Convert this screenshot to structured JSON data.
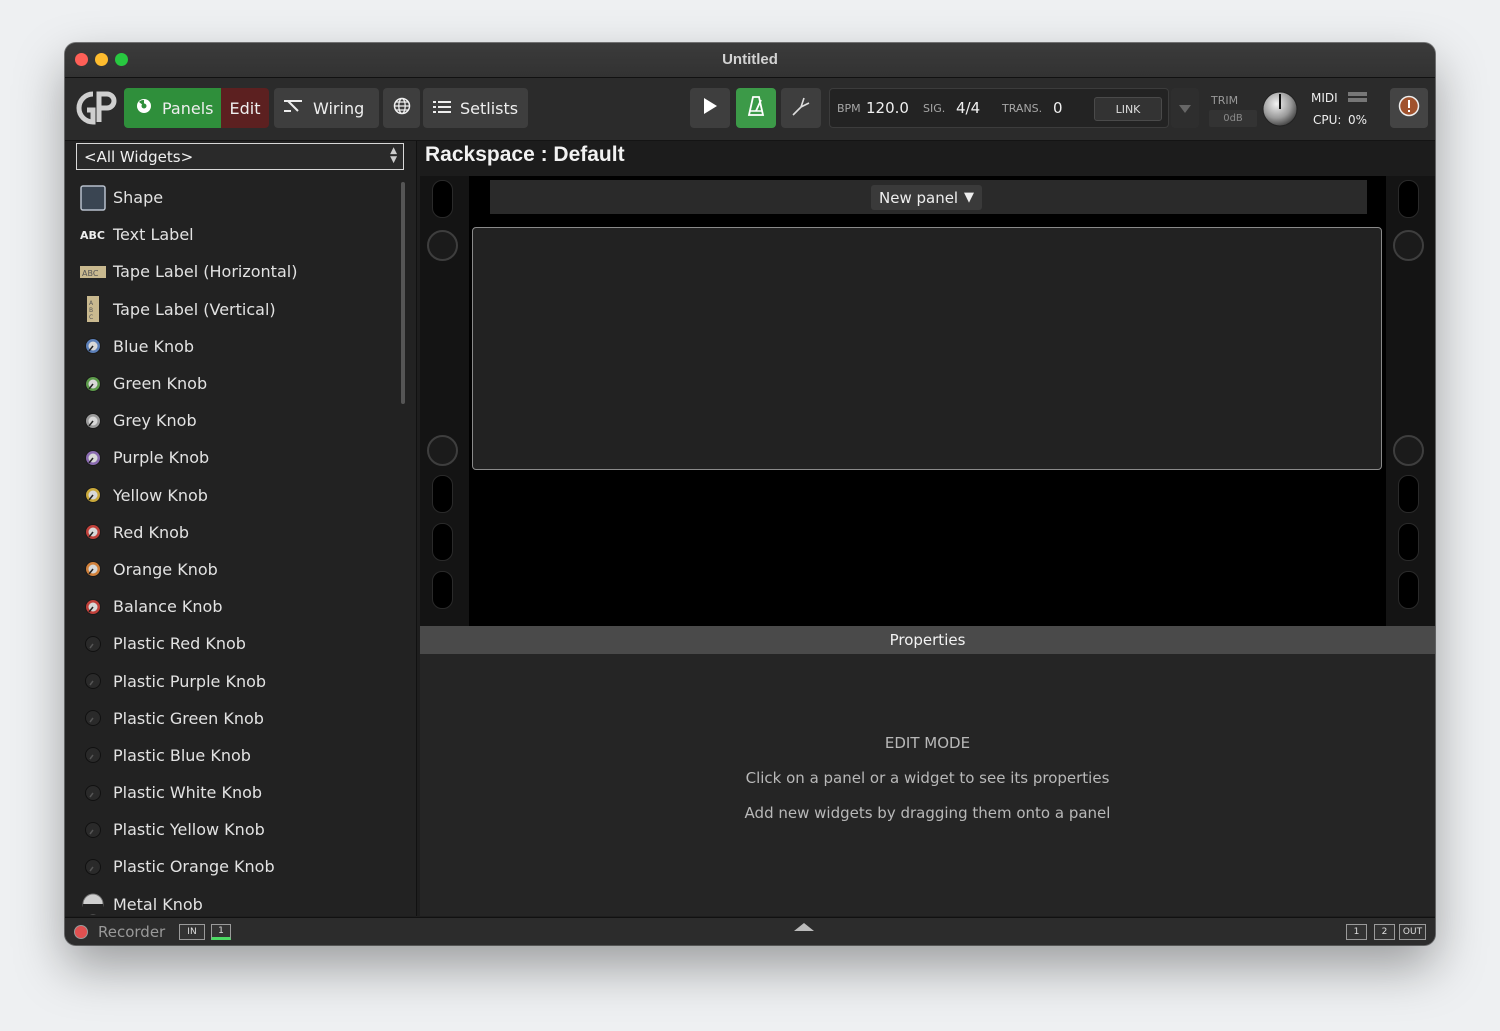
{
  "window": {
    "title": "Untitled"
  },
  "toolbar": {
    "panels_label": "Panels",
    "edit_label": "Edit",
    "wiring_label": "Wiring",
    "setlists_label": "Setlists",
    "bpm_label": "BPM",
    "bpm_value": "120.0",
    "sig_label": "SIG.",
    "sig_value": "4/4",
    "trans_label": "TRANS.",
    "trans_value": "0",
    "link_label": "LINK",
    "trim_label": "TRIM",
    "trim_value": "0dB",
    "midi_label": "MIDI",
    "cpu_label": "CPU:",
    "cpu_value": "0%"
  },
  "sidebar": {
    "filter_value": "<All Widgets>",
    "items": [
      {
        "label": "Shape",
        "icon": "shape-icon"
      },
      {
        "label": "Text Label",
        "icon": "text-label-icon"
      },
      {
        "label": "Tape Label (Horizontal)",
        "icon": "tape-label-horizontal-icon"
      },
      {
        "label": "Tape Label (Vertical)",
        "icon": "tape-label-vertical-icon"
      },
      {
        "label": "Blue Knob",
        "icon": "blue-knob-icon"
      },
      {
        "label": "Green Knob",
        "icon": "green-knob-icon"
      },
      {
        "label": "Grey Knob",
        "icon": "grey-knob-icon"
      },
      {
        "label": "Purple Knob",
        "icon": "purple-knob-icon"
      },
      {
        "label": "Yellow Knob",
        "icon": "yellow-knob-icon"
      },
      {
        "label": "Red Knob",
        "icon": "red-knob-icon"
      },
      {
        "label": "Orange Knob",
        "icon": "orange-knob-icon"
      },
      {
        "label": "Balance Knob",
        "icon": "balance-knob-icon"
      },
      {
        "label": "Plastic Red Knob",
        "icon": "plastic-red-knob-icon"
      },
      {
        "label": "Plastic Purple Knob",
        "icon": "plastic-purple-knob-icon"
      },
      {
        "label": "Plastic Green Knob",
        "icon": "plastic-green-knob-icon"
      },
      {
        "label": "Plastic Blue Knob",
        "icon": "plastic-blue-knob-icon"
      },
      {
        "label": "Plastic White Knob",
        "icon": "plastic-white-knob-icon"
      },
      {
        "label": "Plastic Yellow Knob",
        "icon": "plastic-yellow-knob-icon"
      },
      {
        "label": "Plastic Orange Knob",
        "icon": "plastic-orange-knob-icon"
      },
      {
        "label": "Metal Knob",
        "icon": "metal-knob-icon"
      }
    ]
  },
  "main": {
    "rackspace_title": "Rackspace : Default",
    "new_panel_label": "New panel"
  },
  "properties": {
    "header": "Properties",
    "mode": "EDIT MODE",
    "hint1": "Click on a panel or a widget to see its properties",
    "hint2": "Add new widgets by dragging them onto a panel"
  },
  "statusbar": {
    "recorder_label": "Recorder",
    "in_label": "IN",
    "in_channel": "1",
    "out_channel_1": "1",
    "out_channel_2": "2",
    "out_label": "OUT"
  },
  "colors": {
    "panels_active": "#2f8f3b",
    "edit_active": "#5c2020",
    "metronome_active": "#3c9a48",
    "recorder_dot": "#e05050"
  }
}
